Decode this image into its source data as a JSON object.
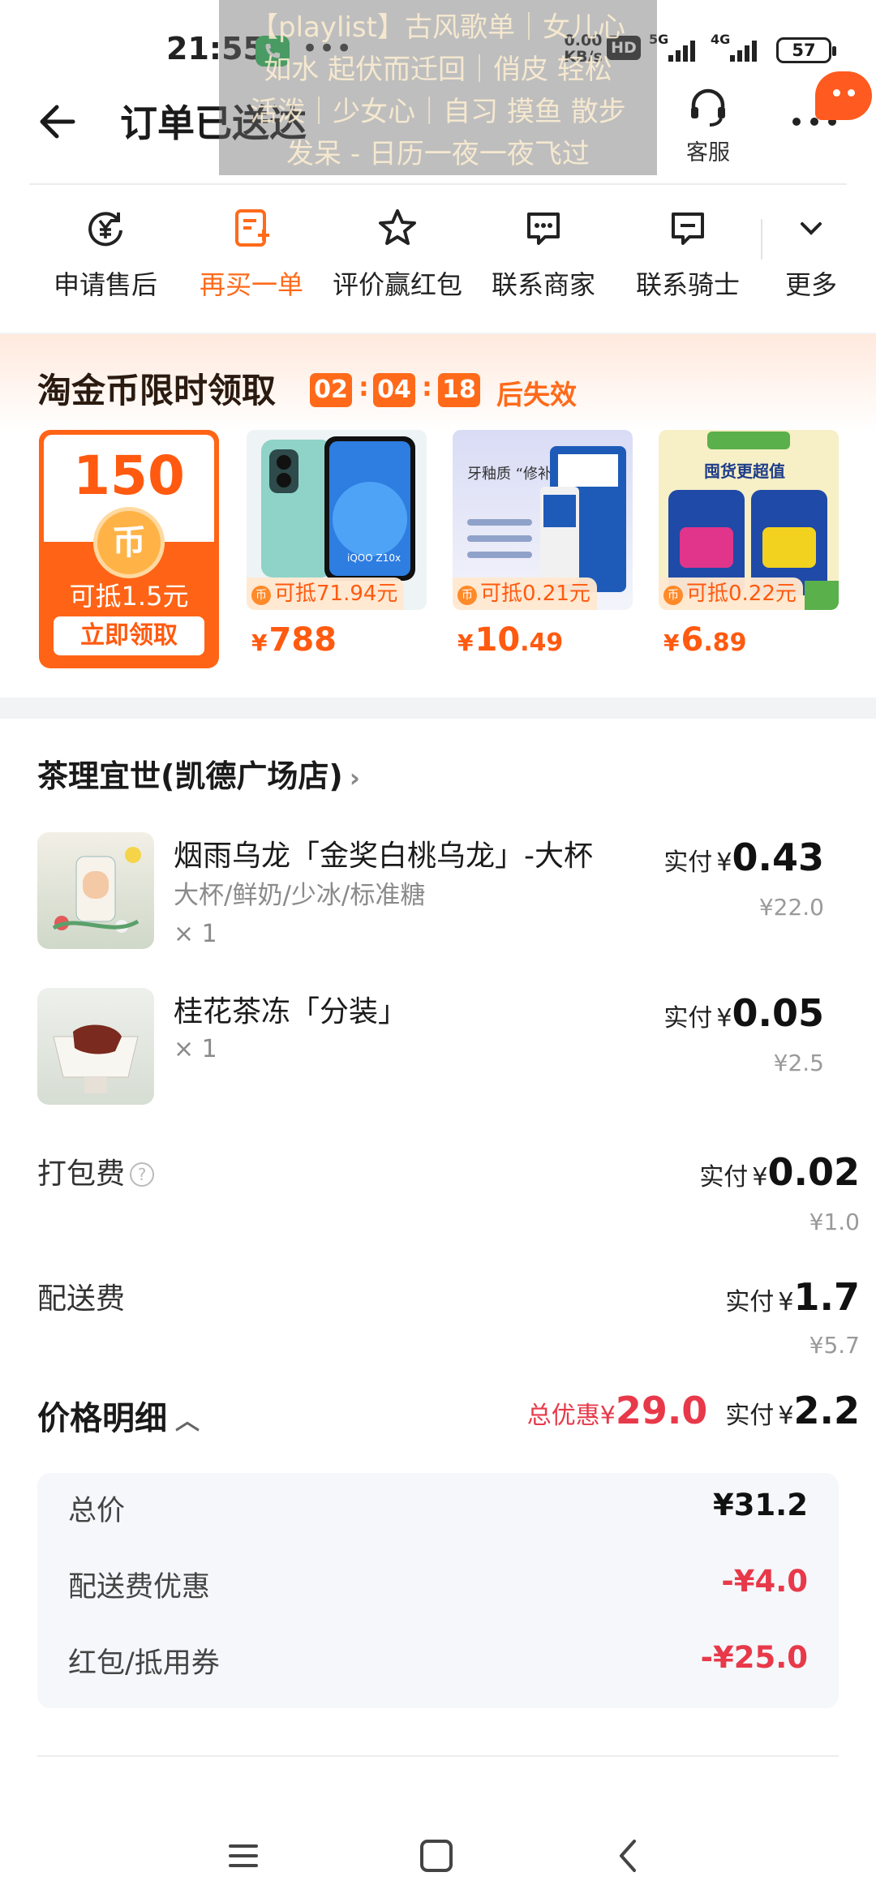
{
  "status_bar": {
    "time": "21:55",
    "more": "•••",
    "net_speed_top": "0.00",
    "net_speed_bottom": "KB/s",
    "hd_badge": "HD",
    "signal1": "5G",
    "signal2": "4G",
    "battery": "57"
  },
  "overlay_banner": {
    "line1": "【playlist】古风歌单｜女儿心",
    "line2": "如水 起伏而迁回｜俏皮 轻松",
    "line3": "活泼｜少女心｜自习 摸鱼 散步",
    "line4": "发呆 - 日历一夜一夜飞过"
  },
  "header": {
    "title": "订单已送达",
    "service_label": "客服"
  },
  "actions": [
    {
      "label": "申请售后",
      "icon": "yuan-refresh-icon"
    },
    {
      "label": "再买一单",
      "icon": "reorder-icon"
    },
    {
      "label": "评价赢红包",
      "icon": "star-icon"
    },
    {
      "label": "联系商家",
      "icon": "chat-icon"
    },
    {
      "label": "联系骑士",
      "icon": "chat-icon"
    },
    {
      "label": "更多",
      "icon": "chevron-down-icon"
    }
  ],
  "promo": {
    "title": "淘金币限时领取",
    "countdown": [
      "02",
      "04",
      "18"
    ],
    "expire_text": "后失效",
    "coin_card": {
      "amount": "150",
      "coin_symbol": "币",
      "value_text": "可抵1.5元",
      "button": "立即领取"
    },
    "products": [
      {
        "tag": "可抵71.94元",
        "currency": "¥",
        "price_int": "788",
        "price_dec": "",
        "image_text": "iQOO Z10x"
      },
      {
        "tag": "可抵0.21元",
        "currency": "¥",
        "price_int": "10",
        "price_dec": ".49",
        "image_text": "牙釉质 “修补匠”"
      },
      {
        "tag": "可抵0.22元",
        "currency": "¥",
        "price_int": "6",
        "price_dec": ".89",
        "image_text": "囤货更超值"
      }
    ]
  },
  "order": {
    "store_name": "茶理宜世(凯德广场店)",
    "paid_label": "实付",
    "currency": "¥",
    "items": [
      {
        "name": "烟雨乌龙「金奖白桃乌龙」-大杯",
        "spec": "大杯/鲜奶/少冰/标准糖",
        "qty": "× 1",
        "paid": "0.43",
        "original": "¥22.0"
      },
      {
        "name": "桂花茶冻「分装」",
        "spec": "",
        "qty": "× 1",
        "paid": "0.05",
        "original": "¥2.5"
      }
    ],
    "packing_fee": {
      "label": "打包费",
      "paid": "0.02",
      "original": "¥1.0"
    },
    "delivery_fee": {
      "label": "配送费",
      "paid": "1.7",
      "original": "¥5.7"
    },
    "price_detail": {
      "title": "价格明细",
      "total_discount_label": "总优惠",
      "total_discount_value": "29.0",
      "paid_value": "2.2",
      "rows": [
        {
          "label": "总价",
          "value": "¥31.2"
        },
        {
          "label": "配送费优惠",
          "value": "-¥4.0"
        },
        {
          "label": "红包/抵用券",
          "value": "-¥25.0"
        }
      ]
    }
  },
  "colors": {
    "accent": "#ff6a1a",
    "discount_red": "#e8394a",
    "page_bg": "#f2f3f5"
  }
}
